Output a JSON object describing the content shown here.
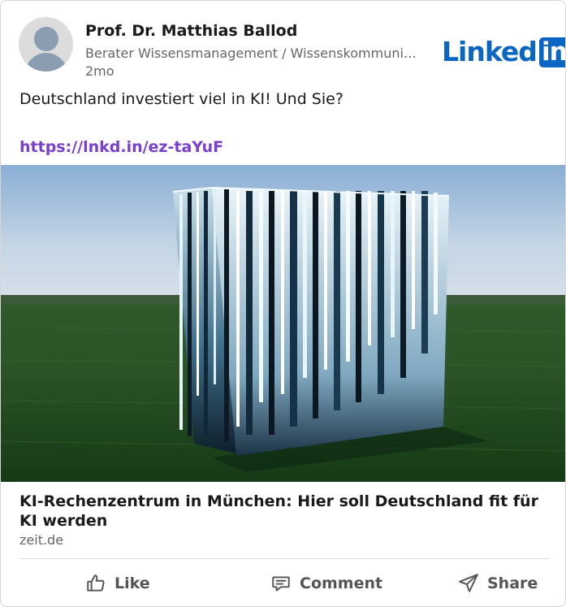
{
  "post": {
    "author": "Prof. Dr. Matthias Ballod",
    "subtitle": "Berater Wissensmanagement / Wissenskommunik...",
    "time": "2mo",
    "text": "Deutschland investiert viel in KI! Und Sie?",
    "link": "https://lnkd.in/ez-taYuF",
    "brand": {
      "word": "Linked",
      "box": "in",
      "color": "#0a66c2"
    }
  },
  "article": {
    "title": "KI-Rechenzentrum in München: Hier soll Deutschland fit für KI werden",
    "source": "zeit.de"
  },
  "actions": {
    "like": "Like",
    "comment": "Comment",
    "share": "Share"
  },
  "icons": {
    "like": "thumbs-up-icon",
    "comment": "comment-bubble-icon",
    "share": "paper-plane-icon"
  },
  "colors": {
    "link": "#7b3fd0",
    "brand": "#0a66c2",
    "muted": "#666666"
  }
}
